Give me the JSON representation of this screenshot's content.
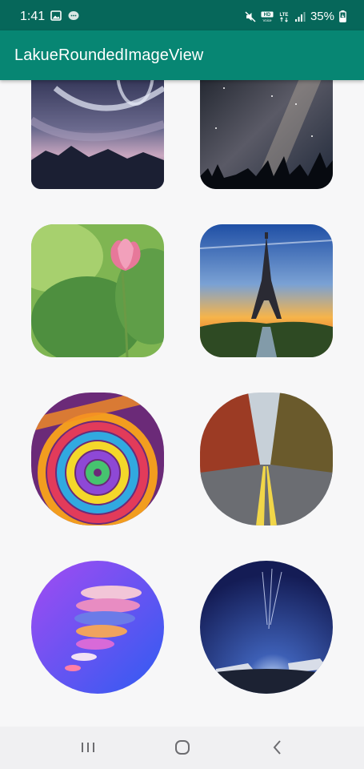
{
  "status_bar": {
    "time": "1:41",
    "left_icons": [
      "image-icon",
      "chat-badge-icon"
    ],
    "right_icons": [
      "mute-icon",
      "hd-voice-icon",
      "lte-icon",
      "signal-icon"
    ],
    "battery_percent": "35%"
  },
  "app_bar": {
    "title": "LakueRoundedImageView"
  },
  "images": [
    {
      "name": "stormy-sky-mountains",
      "corner_style": "rounded-bottom"
    },
    {
      "name": "milky-way-forest",
      "corner_style": "rounded-bottom"
    },
    {
      "name": "pink-lotus",
      "corner_style": "rounded"
    },
    {
      "name": "eiffel-tower-sunset",
      "corner_style": "rounded"
    },
    {
      "name": "colorful-swirl",
      "corner_style": "squircle"
    },
    {
      "name": "autumn-road",
      "corner_style": "squircle"
    },
    {
      "name": "abstract-sphere",
      "corner_style": "circle"
    },
    {
      "name": "night-airshow",
      "corner_style": "circle"
    }
  ],
  "nav_bar": {
    "buttons": [
      "recent-apps-icon",
      "home-icon",
      "back-icon"
    ]
  },
  "colors": {
    "status_bar": "#06675a",
    "app_bar": "#078673",
    "background": "#f7f7f8"
  }
}
